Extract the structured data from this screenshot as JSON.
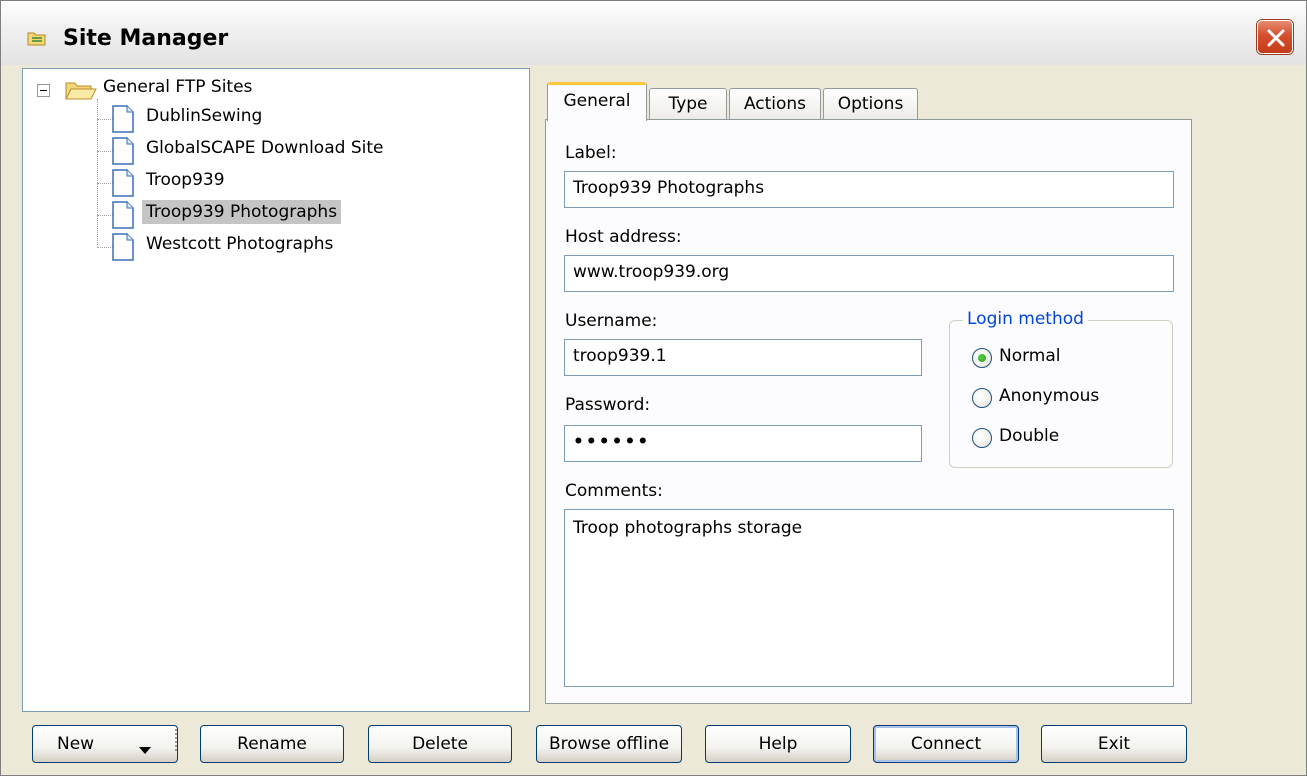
{
  "window": {
    "title": "Site Manager",
    "title_icon": "folder-app-icon",
    "close_icon": "close-icon"
  },
  "tree": {
    "root": {
      "label": "General FTP Sites",
      "icon": "folder-open-icon",
      "expanded": true
    },
    "items": [
      {
        "label": "DublinSewing",
        "icon": "page-icon",
        "selected": false
      },
      {
        "label": "GlobalSCAPE Download Site",
        "icon": "page-icon",
        "selected": false
      },
      {
        "label": "Troop939",
        "icon": "page-icon",
        "selected": false
      },
      {
        "label": "Troop939 Photographs",
        "icon": "page-icon",
        "selected": true
      },
      {
        "label": "Westcott Photographs",
        "icon": "page-icon",
        "selected": false
      }
    ]
  },
  "tabs": [
    {
      "label": "General",
      "active": true
    },
    {
      "label": "Type",
      "active": false
    },
    {
      "label": "Actions",
      "active": false
    },
    {
      "label": "Options",
      "active": false
    }
  ],
  "form": {
    "label_caption": "Label:",
    "label_value": "Troop939 Photographs",
    "host_caption": "Host address:",
    "host_value": "www.troop939.org",
    "username_caption": "Username:",
    "username_value": "troop939.1",
    "password_caption": "Password:",
    "password_value": "••••••",
    "comments_caption": "Comments:",
    "comments_value": "Troop photographs storage"
  },
  "login_method": {
    "title": "Login method",
    "options": [
      {
        "label": "Normal",
        "checked": true
      },
      {
        "label": "Anonymous",
        "checked": false
      },
      {
        "label": "Double",
        "checked": false
      }
    ]
  },
  "buttons": {
    "new": "New",
    "rename": "Rename",
    "delete": "Delete",
    "browse_offline": "Browse offline",
    "help": "Help",
    "connect": "Connect",
    "exit": "Exit"
  },
  "colors": {
    "window_bg": "#ece9d8",
    "selection": "#c5c5c5",
    "group_title": "#0046d5",
    "tab_highlight": "#ffc83c"
  }
}
